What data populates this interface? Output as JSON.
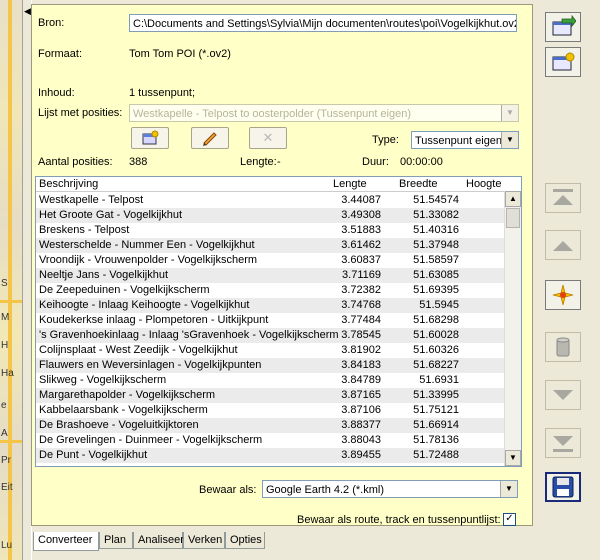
{
  "source": {
    "label": "Bron:",
    "value": "C:\\Documents and Settings\\Sylvia\\Mijn documenten\\routes\\poi\\Vogelkijkhut.ov2"
  },
  "format": {
    "label": "Formaat:",
    "value": "Tom Tom POI (*.ov2)"
  },
  "content": {
    "label": "Inhoud:",
    "value": "1 tussenpunt;"
  },
  "position_list": {
    "label": "Lijst met posities:",
    "value": "Westkapelle - Telpost to oosterpolder (Tussenpunt eigen)"
  },
  "type": {
    "label": "Type:",
    "value": "Tussenpunt eigen"
  },
  "stats": {
    "positions_label": "Aantal posities:",
    "positions_value": "388",
    "length_label": "Lengte:",
    "length_value": "-",
    "duration_label": "Duur:",
    "duration_value": "00:00:00"
  },
  "table": {
    "headers": [
      "Beschrijving",
      "Lengte",
      "Breedte",
      "Hoogte"
    ],
    "rows": [
      [
        "Westkapelle - Telpost",
        "3.44087",
        "51.54574"
      ],
      [
        "Het Groote Gat - Vogelkijkhut",
        "3.49308",
        "51.33082"
      ],
      [
        "Breskens - Telpost",
        "3.51883",
        "51.40316"
      ],
      [
        "Westerschelde - Nummer Een - Vogelkijkhut",
        "3.61462",
        "51.37948"
      ],
      [
        "Vroondijk - Vrouwenpolder - Vogelkijkscherm",
        "3.60837",
        "51.58597"
      ],
      [
        "Neeltje Jans - Vogelkijkhut",
        "3.71169",
        "51.63085"
      ],
      [
        "De Zeepeduinen - Vogelkijkscherm",
        "3.72382",
        "51.69395"
      ],
      [
        "Keihoogte - Inlaag Keihoogte - Vogelkijkhut",
        "3.74768",
        "51.5945"
      ],
      [
        "Koudekerkse inlaag - Plompetoren - Uitkijkpunt",
        "3.77484",
        "51.68298"
      ],
      [
        "'s Gravenhoekinlaag - Inlaag 'sGravenhoek - Vogelkijkscherm",
        "3.78545",
        "51.60028"
      ],
      [
        "Colijnsplaat - West Zeedijk - Vogelkijkhut",
        "3.81902",
        "51.60326"
      ],
      [
        "Flauwers en Weversinlagen - Vogelkijkpunten",
        "3.84183",
        "51.68227"
      ],
      [
        "Slikweg - Vogelkijkscherm",
        "3.84789",
        "51.6931"
      ],
      [
        "Margarethapolder - Vogelkijkscherm",
        "3.87165",
        "51.33995"
      ],
      [
        "Kabbelaarsbank - Vogelkijkscherm",
        "3.87106",
        "51.75121"
      ],
      [
        "De Brashoeve - Vogeluitkijktoren",
        "3.88377",
        "51.66914"
      ],
      [
        "De Grevelingen - Duinmeer - Vogelkijkscherm",
        "3.88043",
        "51.78136"
      ],
      [
        "De Punt - Vogelkijkhut",
        "3.89455",
        "51.72488"
      ]
    ]
  },
  "save_as": {
    "label": "Bewaar als:",
    "value": "Google Earth 4.2 (*.kml)"
  },
  "save_route": {
    "label": "Bewaar als route, track en tussenpuntlijst:",
    "checked": "✓"
  },
  "tabs": [
    "Converteer",
    "Plan",
    "Analiseer",
    "Verken",
    "Opties"
  ],
  "map_labels": [
    "S",
    "M",
    "H",
    "Ha",
    "e",
    "A",
    "Pr",
    "Eit",
    "Lu"
  ],
  "colors": {
    "panel": "#ffffc8",
    "window": "#ece9d8",
    "map_road": "#f5c54a",
    "border": "#7f9db9"
  }
}
